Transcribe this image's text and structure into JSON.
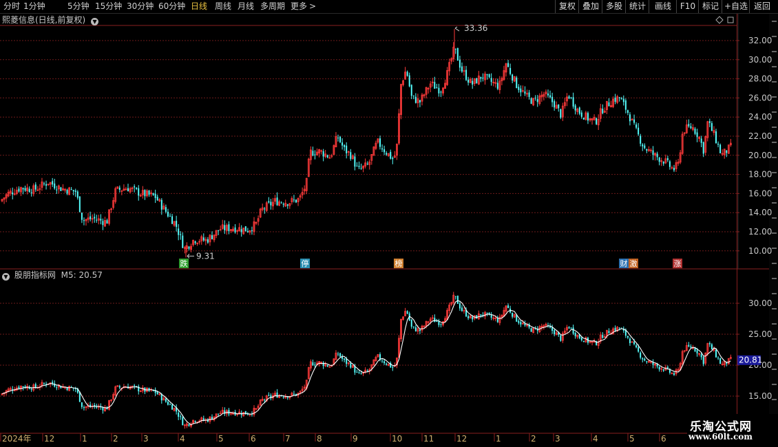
{
  "toolbar": {
    "periods": [
      "分时",
      "1分钟",
      "5分钟",
      "15分钟",
      "30分钟",
      "60分钟",
      "日线",
      "周线",
      "月线",
      "多周期",
      "更多"
    ],
    "active_period": "日线",
    "more_arrow": ">",
    "right_buttons": [
      "复权",
      "叠加",
      "多股",
      "统计",
      "画线",
      "F10",
      "标记",
      "+自选",
      "返回"
    ]
  },
  "main_panel": {
    "title": "熙菱信息(日线,前复权)",
    "diamond_icon": "diamond-icon",
    "y_ticks": [
      "32.00",
      "30.00",
      "28.00",
      "26.00",
      "24.00",
      "22.00",
      "20.00",
      "18.00",
      "16.00",
      "14.00",
      "12.00",
      "10.00"
    ],
    "max_label": "33.36",
    "min_label": "9.31",
    "markers": [
      {
        "text": "跌",
        "color": "#2e9e2e"
      },
      {
        "text": "停",
        "color": "#2a8fb0"
      },
      {
        "text": "榜",
        "color": "#d08030"
      },
      {
        "text": "财",
        "color": "#2a6fb0"
      },
      {
        "text": "激",
        "color": "#c06020"
      },
      {
        "text": "涨",
        "color": "#b03030"
      }
    ]
  },
  "indicator_panel": {
    "title": "股朋指标网",
    "m5_label": "M5: 20.57",
    "y_ticks": [
      "30.00",
      "25.00",
      "20.00",
      "15.00"
    ],
    "current_value_tag": "20.81"
  },
  "x_axis": {
    "labels": [
      "2024年",
      "12",
      "1",
      "2",
      "3",
      "4",
      "5",
      "6",
      "7",
      "8",
      "9",
      "10",
      "11",
      "12",
      "1",
      "2",
      "3",
      "4",
      "5",
      "6"
    ]
  },
  "watermark": {
    "line1": "乐淘公式网",
    "line2": "www.60lt.com"
  },
  "colors": {
    "up": "#ff3a3a",
    "down": "#54fcfc",
    "grid": "#6e1a1a",
    "axis": "#8a1f1f",
    "ma": "#ffffff",
    "active": "#e8c040"
  },
  "chart_data": {
    "type": "candlestick",
    "price_ylim": [
      9.0,
      34.0
    ],
    "indicator_ylim": [
      11.5,
      34.0
    ],
    "anchors": [
      [
        0,
        15.2
      ],
      [
        12,
        16.0
      ],
      [
        30,
        16.6
      ],
      [
        50,
        16.4
      ],
      [
        70,
        17.2
      ],
      [
        90,
        16.5
      ],
      [
        110,
        16.2
      ],
      [
        120,
        13.2
      ],
      [
        135,
        13.4
      ],
      [
        155,
        13.0
      ],
      [
        168,
        16.3
      ],
      [
        185,
        16.6
      ],
      [
        205,
        16.0
      ],
      [
        225,
        15.7
      ],
      [
        240,
        14.2
      ],
      [
        255,
        12.8
      ],
      [
        268,
        10.2
      ],
      [
        282,
        11.2
      ],
      [
        300,
        11.1
      ],
      [
        320,
        12.3
      ],
      [
        340,
        12.4
      ],
      [
        360,
        12.2
      ],
      [
        372,
        12.8
      ],
      [
        380,
        14.3
      ],
      [
        400,
        15.2
      ],
      [
        420,
        15.1
      ],
      [
        435,
        15.4
      ],
      [
        445,
        17.0
      ],
      [
        450,
        20.3
      ],
      [
        465,
        20.4
      ],
      [
        480,
        19.8
      ],
      [
        490,
        22.0
      ],
      [
        500,
        20.6
      ],
      [
        510,
        20.0
      ],
      [
        520,
        18.4
      ],
      [
        535,
        19.0
      ],
      [
        548,
        21.4
      ],
      [
        560,
        20.4
      ],
      [
        572,
        19.5
      ],
      [
        577,
        21.2
      ],
      [
        582,
        27.3
      ],
      [
        590,
        29.0
      ],
      [
        598,
        26.0
      ],
      [
        610,
        25.6
      ],
      [
        625,
        27.5
      ],
      [
        640,
        26.8
      ],
      [
        650,
        28.6
      ],
      [
        660,
        31.2
      ],
      [
        670,
        29.0
      ],
      [
        685,
        27.4
      ],
      [
        700,
        28.3
      ],
      [
        715,
        27.6
      ],
      [
        725,
        27.2
      ],
      [
        735,
        29.6
      ],
      [
        750,
        27.4
      ],
      [
        765,
        26.1
      ],
      [
        775,
        25.6
      ],
      [
        790,
        26.4
      ],
      [
        805,
        25.4
      ],
      [
        815,
        24.2
      ],
      [
        825,
        26.4
      ],
      [
        840,
        24.6
      ],
      [
        855,
        23.8
      ],
      [
        865,
        23.5
      ],
      [
        875,
        24.8
      ],
      [
        890,
        25.8
      ],
      [
        900,
        26.0
      ],
      [
        912,
        24.5
      ],
      [
        922,
        22.8
      ],
      [
        935,
        20.9
      ],
      [
        950,
        20.0
      ],
      [
        965,
        19.4
      ],
      [
        978,
        18.5
      ],
      [
        985,
        19.0
      ],
      [
        992,
        22.6
      ],
      [
        1005,
        23.0
      ],
      [
        1015,
        22.0
      ],
      [
        1022,
        20.5
      ],
      [
        1028,
        23.5
      ],
      [
        1038,
        22.0
      ],
      [
        1048,
        20.0
      ],
      [
        1062,
        20.9
      ]
    ]
  }
}
